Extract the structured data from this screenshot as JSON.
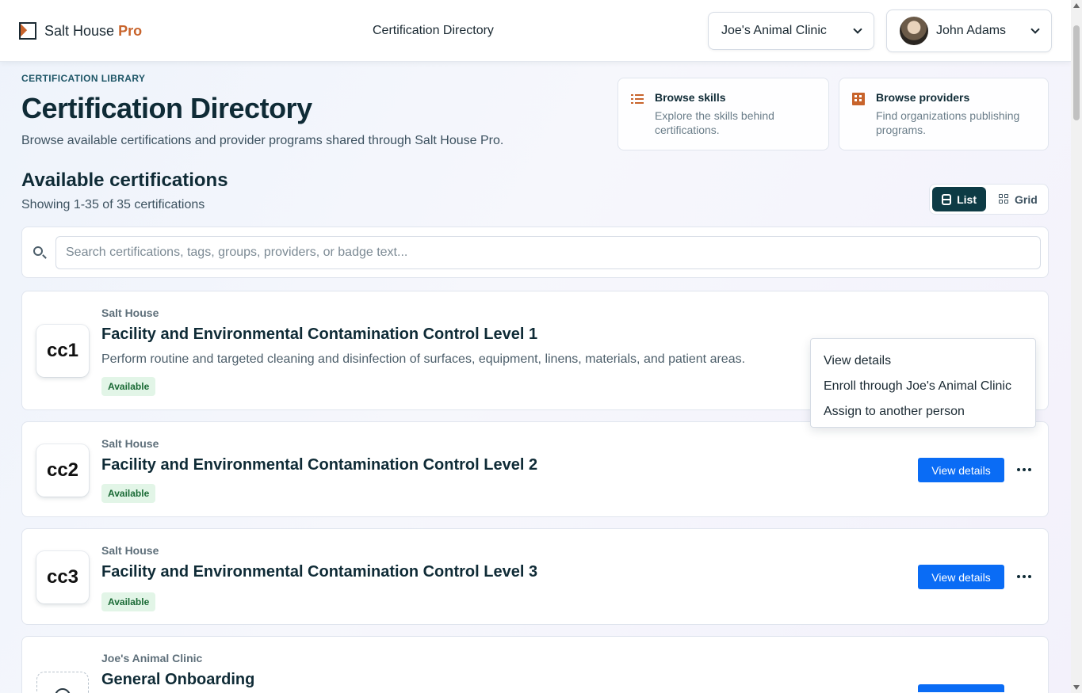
{
  "topbar": {
    "brand_name": "Salt House",
    "brand_accent": "Pro",
    "page_title": "Certification Directory",
    "org_selector": "Joe's Animal Clinic",
    "user_name": "John Adams"
  },
  "header": {
    "eyebrow": "CERTIFICATION LIBRARY",
    "title": "Certification Directory",
    "subtitle": "Browse available certifications and provider programs shared through Salt House Pro."
  },
  "quick_links": [
    {
      "title": "Browse skills",
      "description": "Explore the skills behind certifications.",
      "icon": "list-icon"
    },
    {
      "title": "Browse providers",
      "description": "Find organizations publishing programs.",
      "icon": "building-icon"
    }
  ],
  "section": {
    "title": "Available certifications",
    "count_text": "Showing 1-35 of 35 certifications"
  },
  "view_toggle": {
    "list_label": "List",
    "grid_label": "Grid",
    "selected": "List"
  },
  "search": {
    "placeholder": "Search certifications, tags, groups, providers, or badge text...",
    "value": ""
  },
  "certifications": [
    {
      "code": "cc1",
      "provider": "Salt House",
      "title": "Facility and Environmental Contamination Control Level 1",
      "description": "Perform routine and targeted cleaning and disinfection of surfaces, equipment, linens, materials, and patient areas.",
      "status": "Available"
    },
    {
      "code": "cc2",
      "provider": "Salt House",
      "title": "Facility and Environmental Contamination Control Level 2",
      "status": "Available",
      "action": "View details"
    },
    {
      "code": "cc3",
      "provider": "Salt House",
      "title": "Facility and Environmental Contamination Control Level 3",
      "status": "Available",
      "action": "View details"
    },
    {
      "provider": "Joe's Animal Clinic",
      "title": "General Onboarding",
      "icon": "clock-icon"
    }
  ],
  "context_menu": {
    "items": [
      "View details",
      "Enroll through Joe's Animal Clinic",
      "Assign to another person"
    ]
  },
  "colors": {
    "accent": "#c8642c",
    "primary_button": "#0a6cf5",
    "toggle_active": "#0d3b45",
    "badge_bg": "#e2f5e7",
    "badge_text": "#1a6a35"
  }
}
